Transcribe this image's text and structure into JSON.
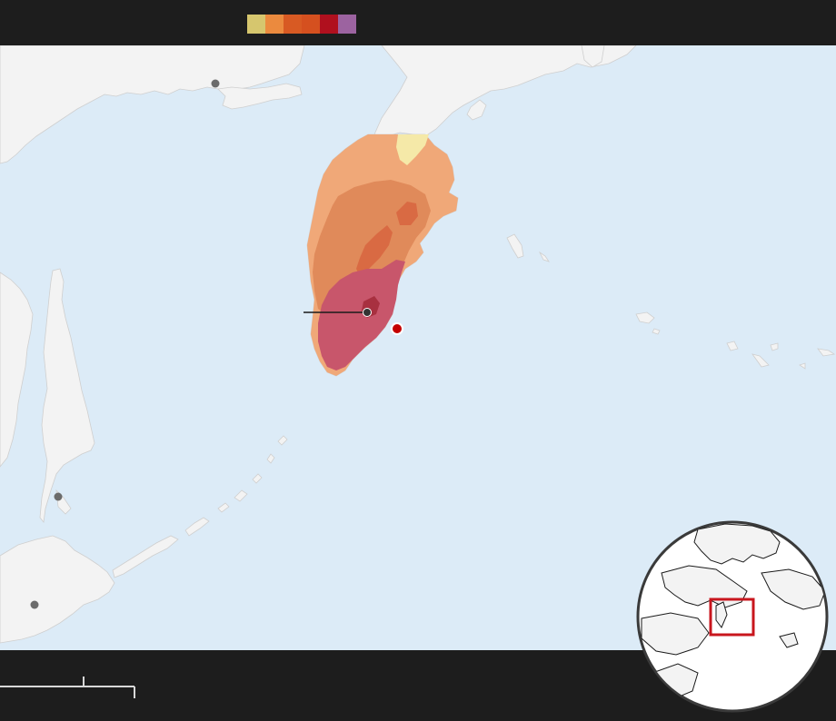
{
  "legend": {
    "colors": [
      "#d6c66e",
      "#eb8a3e",
      "#d85a23",
      "#d5501f",
      "#b0101e",
      "#9c63a0"
    ]
  },
  "map": {
    "background_color": "#dcebf7",
    "land_color": "#f3f3f3",
    "intensity_colors": {
      "weak": "#f5e9a8",
      "light": "#f0a878",
      "moderate": "#e08a5a",
      "strong": "#d96a43",
      "very_strong": "#c8566b",
      "severe": "#a83040"
    },
    "epicenter_color": "#c40000",
    "city_dot_color": "#6b6b6b",
    "cities": [
      "city-1",
      "city-2",
      "city-3",
      "city-4"
    ]
  },
  "locator": {
    "frame_color": "#c8161d"
  }
}
